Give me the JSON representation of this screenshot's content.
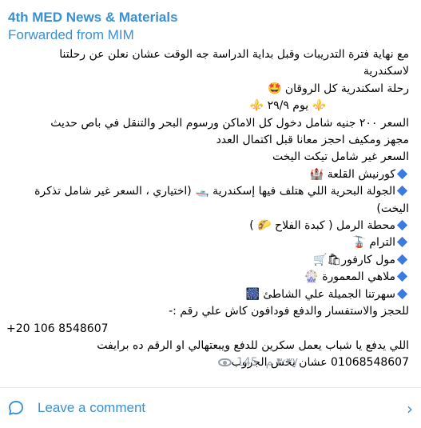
{
  "post": {
    "channel_name": "4th MED News & Materials",
    "forwarded_from": "Forwarded from MIM",
    "lines": [
      "مع نهاية فترة التدريبات وقبل بداية الدراسة جه الوقت عشان نعلن عن رحلتنا",
      "لاسكندرية",
      "رحلة اسكندرية كل الروقان 🤩",
      "⚜️ يوم ٢٩/٩ ⚜️",
      "السعر ٢٠٠ جنيه شامل دخول كل الاماكن ورسوم البحر والتنقل في باص حديث",
      "مجهز ومكيف احجز معانا قبل اكتمال العدد",
      "السعر غير شامل تيكت اليخت"
    ],
    "places": [
      "كورنيش القلعة 🏰",
      "الجولة البحرية اللي هتلف فيها إسكندرية 🛥️ (اختياري ، السعر غير شامل تذكرة اليخت)",
      "محطة الرمل ( كبدة الفلاح 🌮 )",
      "الترام 🚡",
      "مول كارفور🛍🛒",
      "ملاهي المعمورة 🎡",
      "سهرتنا الجميلة علي الشاطئ 🎆"
    ],
    "booking_text": "للحجز والاستفسار والدفع فودافون كاش علي رقم :-",
    "phone": "+20 106 8548607",
    "payment_note": "اللي يدفع يا شباب يعمل سكرين للدفع ويبعتهالي او الرقم ده برايفت",
    "group_note": "01068548607 عشان يخش الجروب",
    "views": "145",
    "time": "٣:٣٧ م"
  },
  "comment_bar": {
    "label": "Leave a comment",
    "icon": "comment-icon",
    "chevron": "chevron-right-icon"
  },
  "colors": {
    "accent": "#3a8fd1",
    "diamond": "#3b7be0",
    "meta": "#98a1aa"
  }
}
